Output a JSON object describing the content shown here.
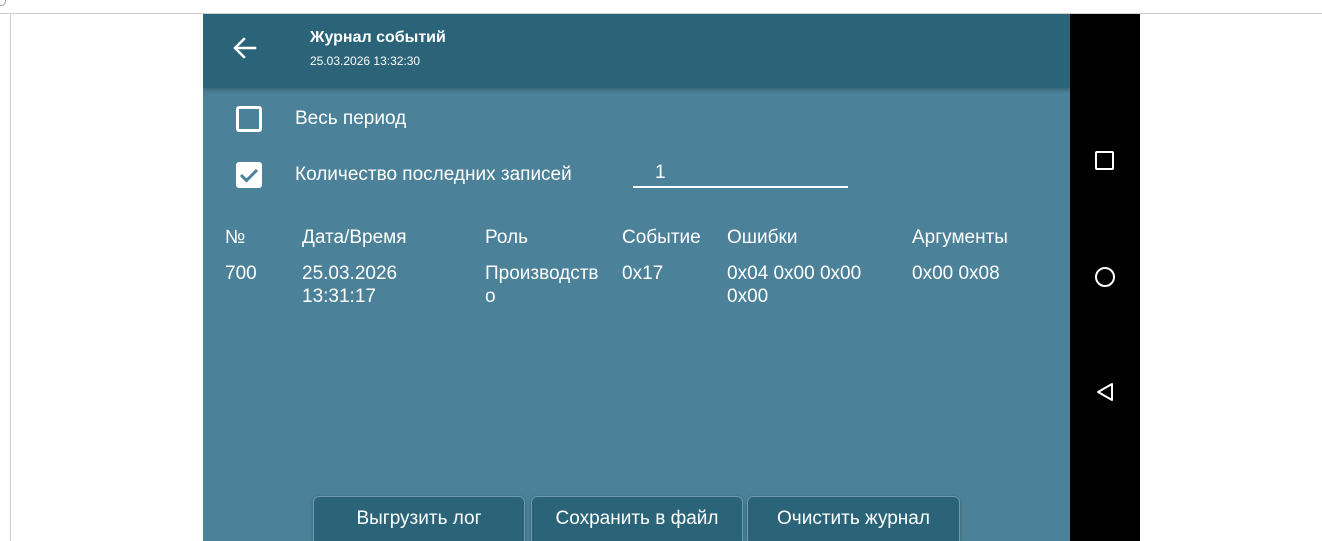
{
  "header": {
    "title": "Журнал событий",
    "subtitle": "25.03.2026 13:32:30"
  },
  "options": {
    "whole_period": {
      "label": "Весь период",
      "checked": false
    },
    "last_records": {
      "label": "Количество последних записей",
      "checked": true,
      "value": "1"
    }
  },
  "table": {
    "columns": [
      "№",
      "Дата/Время",
      "Роль",
      "Событие",
      "Ошибки",
      "Аргументы"
    ],
    "rows": [
      {
        "num": "700",
        "date_line1": "25.03.2026",
        "date_line2": "13:31:17",
        "role_line1": "Производств",
        "role_line2": "о",
        "event": "0x17",
        "errors_line1": "0x04 0x00 0x00",
        "errors_line2": "0x00",
        "args": "0x00 0x08"
      }
    ]
  },
  "buttons": {
    "export": "Выгрузить лог",
    "save": "Сохранить в файл",
    "clear": "Очистить журнал"
  },
  "colors": {
    "appbar": "#2b6479",
    "content": "#4b8299",
    "navbar": "#000000"
  },
  "icons": {
    "back": "arrow-left",
    "nav_recent": "square",
    "nav_home": "circle",
    "nav_back": "triangle-left"
  }
}
